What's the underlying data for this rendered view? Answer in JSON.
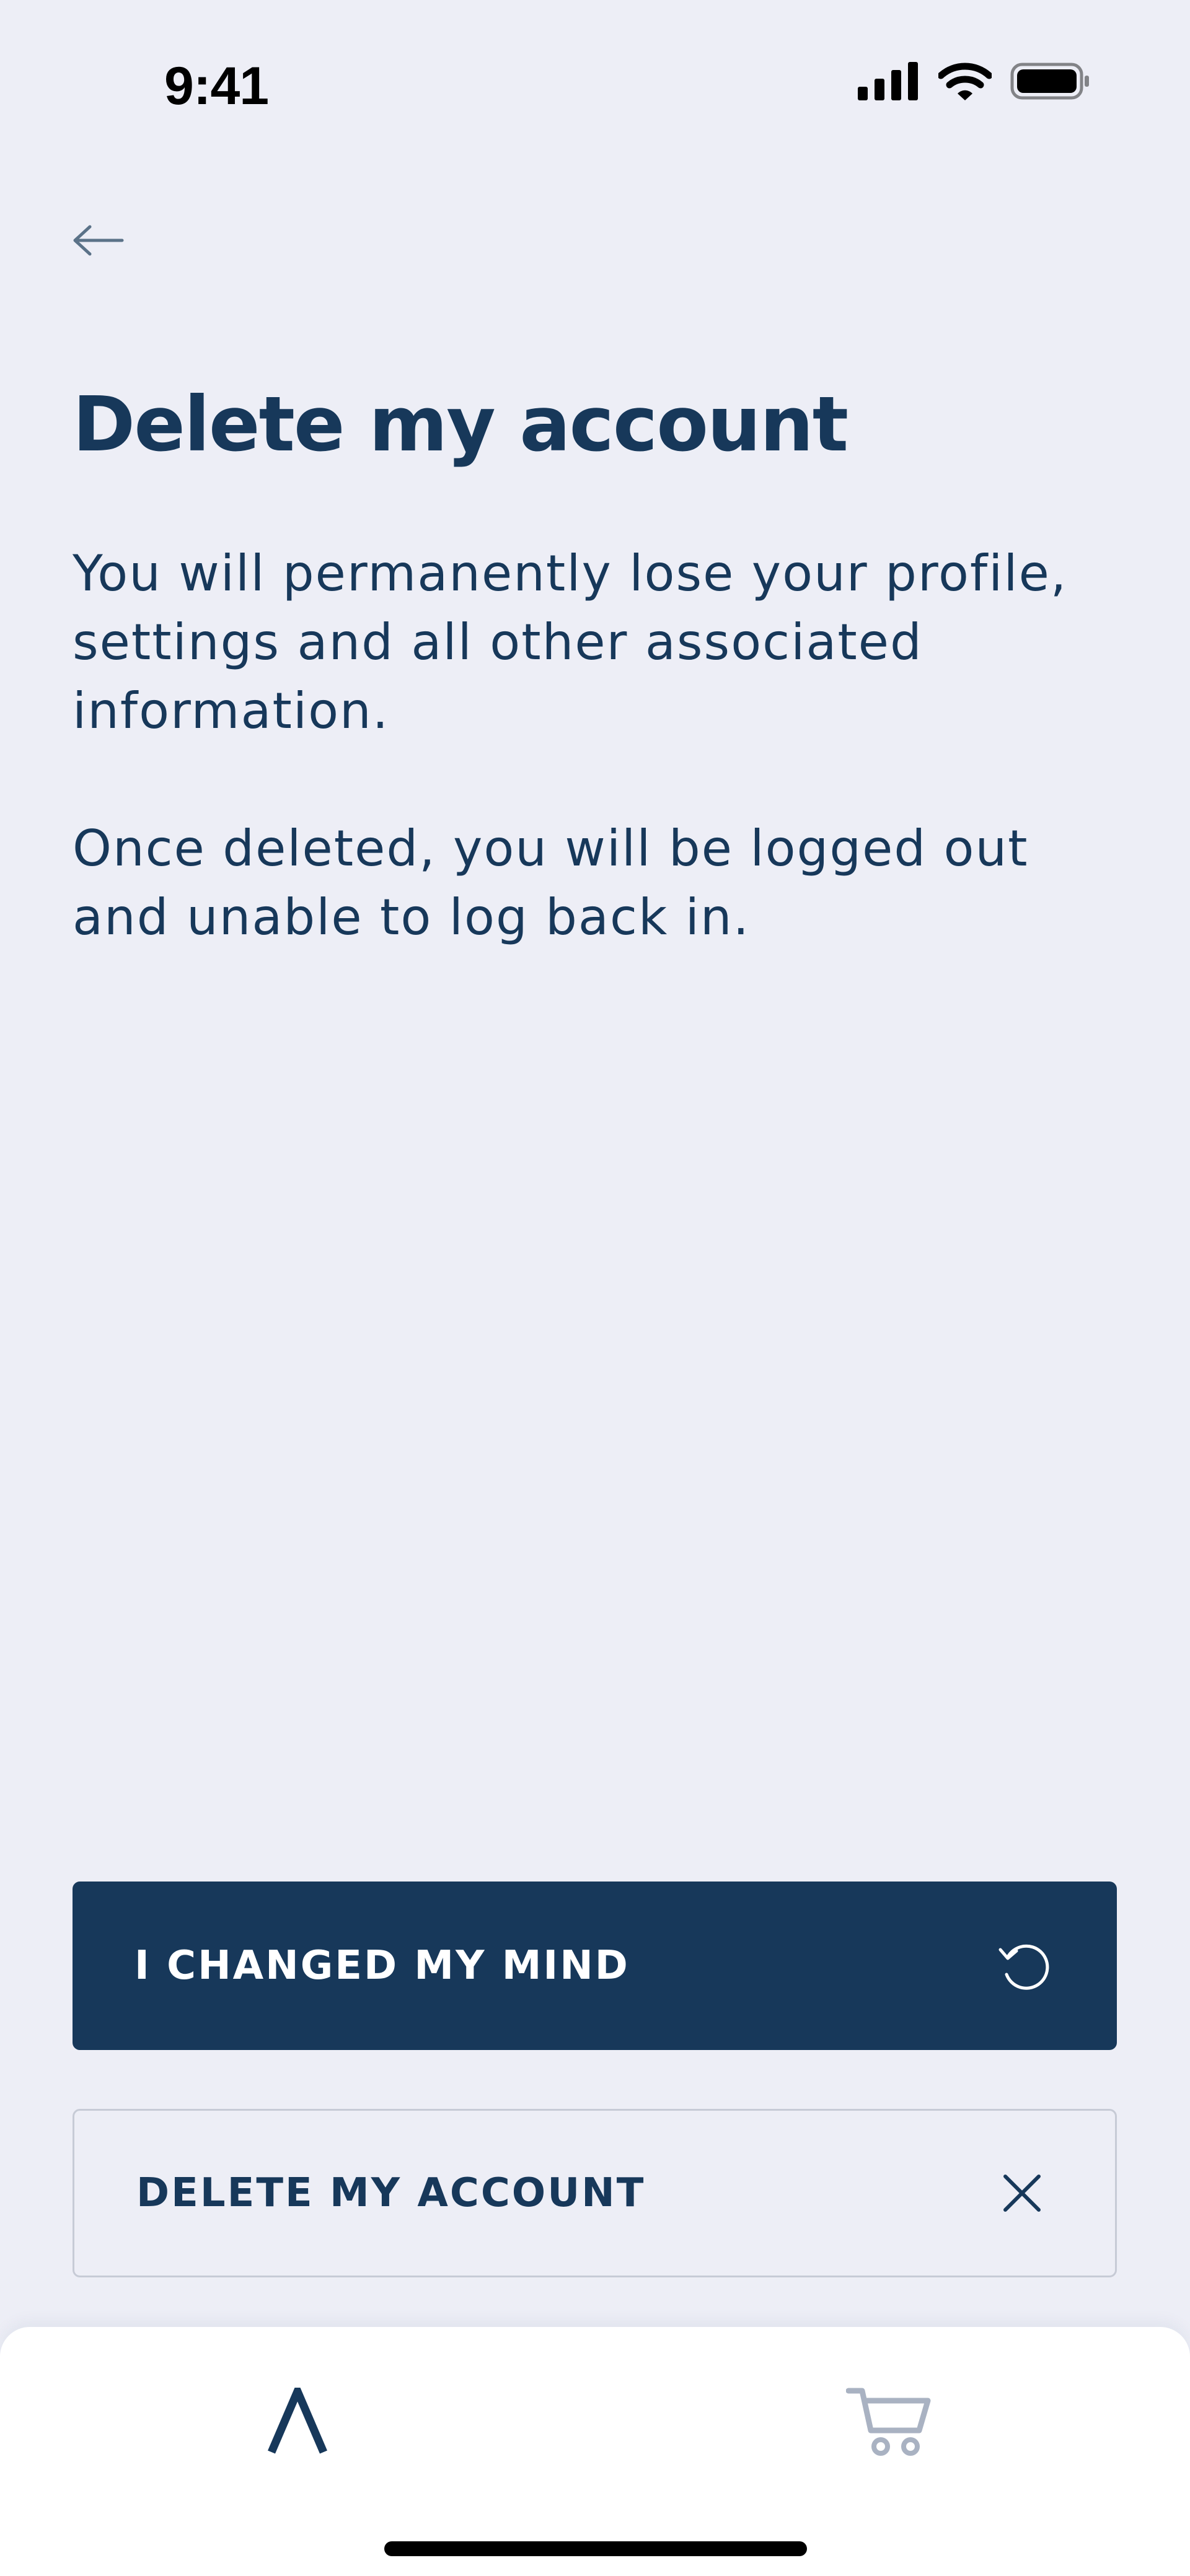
{
  "status_bar": {
    "time": "9:41",
    "icons": [
      "cellular-signal-icon",
      "wifi-icon",
      "battery-icon"
    ]
  },
  "header": {
    "back_icon": "arrow-left-icon"
  },
  "page": {
    "title": "Delete my account",
    "paragraphs": [
      "You will permanently lose your profile,\nsettings and all other associated\ninformation.",
      "Once deleted, you will be logged out\nand unable to log back in."
    ]
  },
  "actions": {
    "primary": {
      "label": "I CHANGED MY MIND",
      "icon": "undo-icon"
    },
    "secondary": {
      "label": "DELETE MY ACCOUNT",
      "icon": "close-icon"
    }
  },
  "bottom_nav": {
    "items": [
      {
        "icon": "lambda-logo-icon",
        "active": true
      },
      {
        "icon": "cart-icon",
        "active": false
      }
    ]
  },
  "colors": {
    "background": "#EDEEF6",
    "primary": "#17385A",
    "border": "#C7CBD6",
    "nav_inactive": "#A9B2C2"
  }
}
